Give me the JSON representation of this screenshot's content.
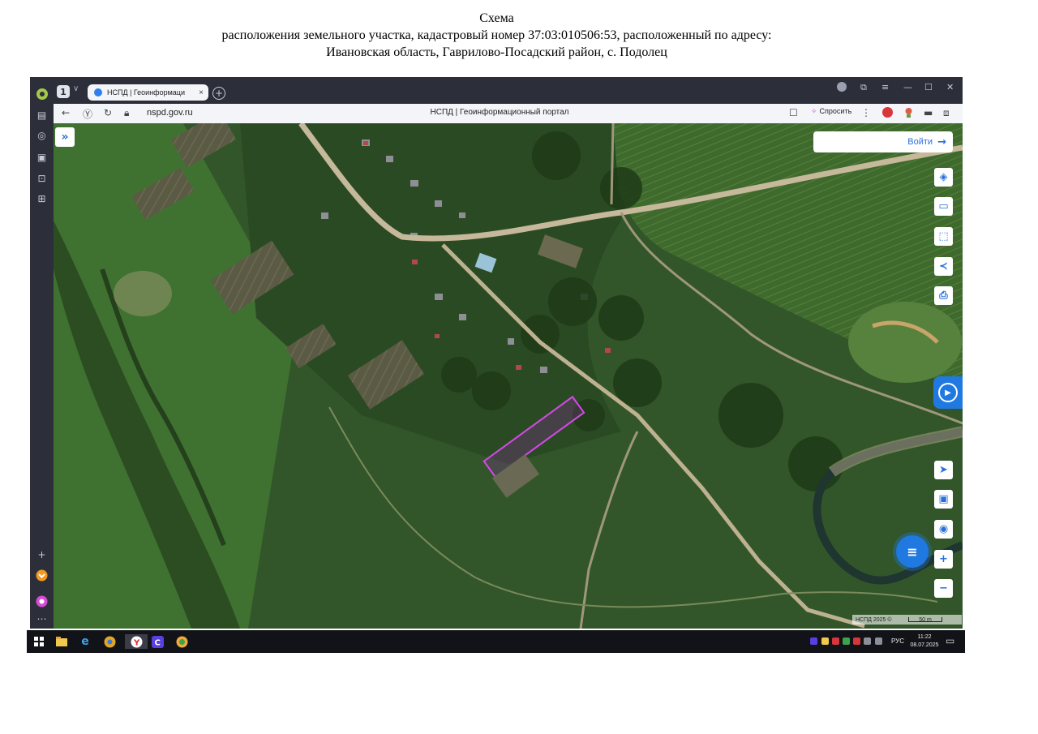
{
  "document": {
    "line1": "Схема",
    "line2": "расположения земельного участка, кадастровый номер 37:03:010506:53, расположенный по адресу:",
    "line3": "Ивановская область, Гаврилово-Посадский район, с. Подолец"
  },
  "browser": {
    "tab_count": "1",
    "tab_title": "НСПД | Геоинформаци",
    "tab_close": "×",
    "new_tab": "+",
    "url": "nspd.gov.ru",
    "page_title": "НСПД | Геоинформационный портал",
    "ask_label": "Спросить",
    "window_controls": [
      "—",
      "☐",
      "✕"
    ]
  },
  "map": {
    "login_label": "Войти",
    "scale_copyright": "НСПД 2025 ©",
    "scale_label": "50 m",
    "highlight_color": "#c23bd6",
    "tools": [
      "layers-icon",
      "ruler-icon",
      "select-area-icon",
      "share-icon",
      "print-icon"
    ],
    "nav_tools": [
      "locate-icon",
      "minimap-icon",
      "pin-icon"
    ],
    "zoom_in": "+",
    "zoom_out": "−"
  },
  "taskbar": {
    "apps": [
      "windows-start-icon",
      "file-explorer-icon",
      "edge-icon",
      "chrome-icon",
      "yandex-browser-icon",
      "c-app-icon",
      "app-icon"
    ],
    "language": "РУС",
    "time": "11:22",
    "date": "08.07.2025"
  },
  "colors": {
    "accent": "#1f79e0",
    "browser_chrome": "#2c2f3a",
    "taskbar": "#111318"
  }
}
